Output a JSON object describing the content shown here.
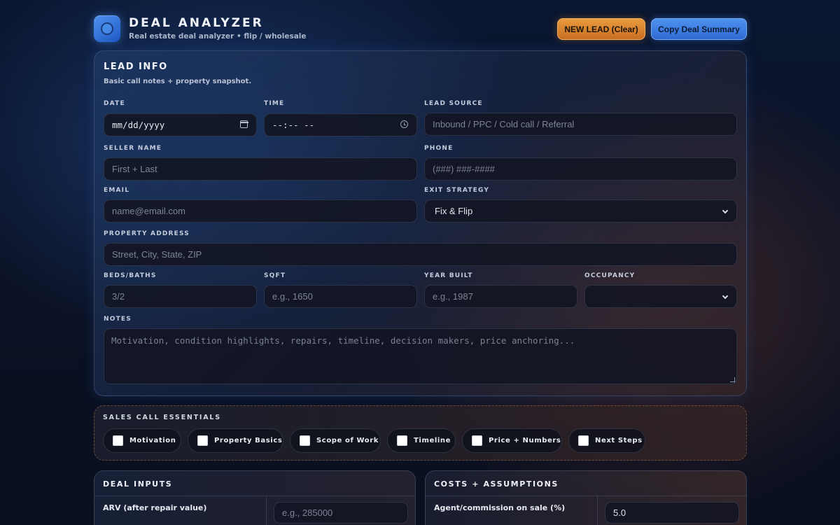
{
  "header": {
    "title": "DEAL ANALYZER",
    "subtitle": "Real estate deal analyzer • flip / wholesale",
    "new_lead_label": "NEW LEAD (Clear)",
    "copy_label": "Copy Deal Summary"
  },
  "lead": {
    "title": "LEAD INFO",
    "subtitle": "Basic call notes + property snapshot.",
    "date": {
      "label": "DATE",
      "value": "mm/dd/yyyy"
    },
    "time": {
      "label": "TIME",
      "value": "--:-- --"
    },
    "source": {
      "label": "LEAD SOURCE",
      "placeholder": "Inbound / PPC / Cold call / Referral"
    },
    "seller": {
      "label": "SELLER NAME",
      "placeholder": "First + Last"
    },
    "phone": {
      "label": "PHONE",
      "placeholder": "(###) ###-####"
    },
    "email": {
      "label": "EMAIL",
      "placeholder": "name@email.com"
    },
    "exit": {
      "label": "EXIT STRATEGY",
      "value": "Fix & Flip"
    },
    "address": {
      "label": "PROPERTY ADDRESS",
      "placeholder": "Street, City, State, ZIP"
    },
    "beds": {
      "label": "BEDS/BATHS",
      "placeholder": "3/2"
    },
    "sqft": {
      "label": "SQFT",
      "placeholder": "e.g., 1650"
    },
    "year": {
      "label": "YEAR BUILT",
      "placeholder": "e.g., 1987"
    },
    "occupancy": {
      "label": "OCCUPANCY",
      "value": ""
    },
    "notes": {
      "label": "NOTES",
      "placeholder": "Motivation, condition highlights, repairs, timeline, decision makers, price anchoring..."
    }
  },
  "essentials": {
    "title": "SALES CALL ESSENTIALS",
    "items": [
      {
        "label": "Motivation",
        "checked": false
      },
      {
        "label": "Property Basics",
        "checked": false
      },
      {
        "label": "Scope of Work",
        "checked": false
      },
      {
        "label": "Timeline",
        "checked": false
      },
      {
        "label": "Price + Numbers",
        "checked": false
      },
      {
        "label": "Next Steps",
        "checked": false
      }
    ]
  },
  "deal_inputs": {
    "title": "DEAL INPUTS",
    "arv_label": "ARV (after repair value)",
    "arv_placeholder": "e.g., 285000"
  },
  "costs": {
    "title": "COSTS + ASSUMPTIONS",
    "commission_label": "Agent/commission on sale (%)",
    "commission_value": "5.0"
  }
}
